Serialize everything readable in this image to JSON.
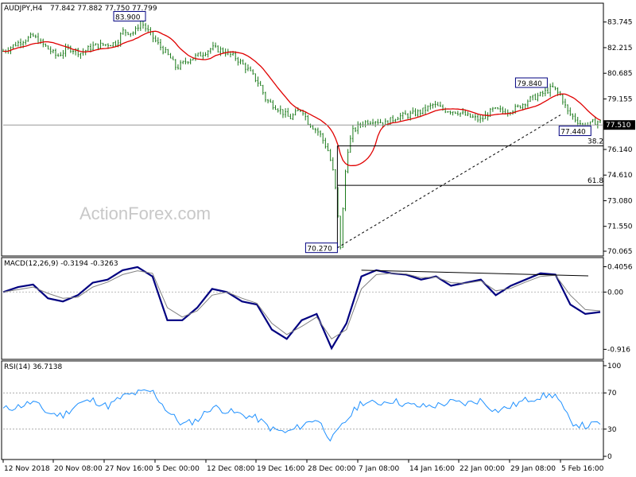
{
  "chart_data": [
    {
      "type": "candlestick",
      "title": "AUDJPY,H4",
      "ohlc_header": "77.842 77.882 77.750 77.799",
      "y_ticks": [
        "83.745",
        "82.215",
        "80.685",
        "79.155",
        "77.510",
        "76.140",
        "74.610",
        "73.080",
        "71.550",
        "70.065"
      ],
      "ylim": [
        70.065,
        84.3
      ],
      "overlay_series": [
        {
          "type": "moving-average",
          "color": "#e00000"
        }
      ],
      "last_price": "77.510",
      "price_line": 77.6,
      "annotations": [
        {
          "text": "83.900",
          "x_date": "1 Dec 2018",
          "value": 83.9
        },
        {
          "text": "70.270",
          "x_date": "3 Jan 2019",
          "value": 70.27
        },
        {
          "text": "79.840",
          "x_date": "1 Feb 2019",
          "value": 79.84
        },
        {
          "text": "77.440",
          "x_date": "7 Feb 2019",
          "value": 77.44
        }
      ],
      "fib_levels": [
        {
          "label": "38.2",
          "value": 76.35
        },
        {
          "label": "61.8",
          "value": 74.0
        }
      ],
      "trendline": {
        "from": {
          "x_date": "3 Jan 2019",
          "value": 70.27
        },
        "to": {
          "x_date": "5 Feb 2019",
          "value": 78.2
        }
      },
      "price_path": [
        [
          0,
          82.0
        ],
        [
          0.03,
          82.6
        ],
        [
          0.05,
          82.9
        ],
        [
          0.07,
          82.3
        ],
        [
          0.09,
          81.7
        ],
        [
          0.11,
          82.2
        ],
        [
          0.13,
          81.9
        ],
        [
          0.15,
          82.3
        ],
        [
          0.17,
          82.4
        ],
        [
          0.19,
          82.5
        ],
        [
          0.2,
          83.2
        ],
        [
          0.22,
          83.1
        ],
        [
          0.23,
          83.8
        ],
        [
          0.24,
          83.3
        ],
        [
          0.26,
          82.4
        ],
        [
          0.28,
          81.6
        ],
        [
          0.29,
          81.0
        ],
        [
          0.31,
          81.5
        ],
        [
          0.33,
          81.8
        ],
        [
          0.35,
          82.2
        ],
        [
          0.37,
          82.0
        ],
        [
          0.39,
          81.6
        ],
        [
          0.41,
          80.9
        ],
        [
          0.43,
          80.0
        ],
        [
          0.44,
          79.1
        ],
        [
          0.46,
          78.6
        ],
        [
          0.48,
          78.0
        ],
        [
          0.5,
          78.6
        ],
        [
          0.51,
          77.8
        ],
        [
          0.53,
          77.1
        ],
        [
          0.545,
          76.0
        ],
        [
          0.555,
          74.4
        ],
        [
          0.565,
          70.3
        ],
        [
          0.575,
          75.8
        ],
        [
          0.585,
          77.2
        ],
        [
          0.6,
          77.7
        ],
        [
          0.62,
          77.9
        ],
        [
          0.64,
          77.7
        ],
        [
          0.66,
          78.1
        ],
        [
          0.68,
          78.2
        ],
        [
          0.7,
          78.4
        ],
        [
          0.72,
          78.8
        ],
        [
          0.74,
          78.5
        ],
        [
          0.76,
          78.4
        ],
        [
          0.78,
          78.1
        ],
        [
          0.8,
          77.9
        ],
        [
          0.82,
          78.5
        ],
        [
          0.84,
          78.4
        ],
        [
          0.86,
          78.6
        ],
        [
          0.88,
          79.1
        ],
        [
          0.9,
          79.4
        ],
        [
          0.92,
          79.84
        ],
        [
          0.935,
          79.3
        ],
        [
          0.945,
          78.4
        ],
        [
          0.96,
          77.9
        ],
        [
          0.975,
          77.44
        ],
        [
          0.99,
          77.8
        ]
      ],
      "x_ticks": [
        "12 Nov 2018",
        "20 Nov 08:00",
        "27 Nov 16:00",
        "5 Dec 00:00",
        "12 Dec 08:00",
        "19 Dec 16:00",
        "28 Dec 00:00",
        "7 Jan 08:00",
        "14 Jan 16:00",
        "22 Jan 00:00",
        "29 Jan 08:00",
        "5 Feb 16:00"
      ]
    },
    {
      "type": "line",
      "title": "MACD(12,26,9) -0.3194 -0.3263",
      "y_ticks": [
        "0.4056",
        "0.00",
        "-0.916"
      ],
      "ylim": [
        -1.0,
        0.45
      ],
      "series": [
        {
          "color": "#000080",
          "values": [
            0.0,
            0.08,
            0.12,
            -0.1,
            -0.15,
            -0.05,
            0.15,
            0.2,
            0.35,
            0.4,
            0.25,
            -0.45,
            -0.45,
            -0.25,
            0.05,
            0.0,
            -0.15,
            -0.2,
            -0.6,
            -0.75,
            -0.45,
            -0.35,
            -0.9,
            -0.5,
            0.25,
            0.35,
            0.3,
            0.28,
            0.2,
            0.25,
            0.1,
            0.15,
            0.2,
            -0.05,
            0.1,
            0.2,
            0.3,
            0.28,
            -0.2,
            -0.35,
            -0.32
          ]
        },
        {
          "color": "#808080",
          "values": [
            0.0,
            0.04,
            0.08,
            -0.02,
            -0.1,
            -0.08,
            0.08,
            0.16,
            0.28,
            0.34,
            0.3,
            -0.25,
            -0.4,
            -0.3,
            -0.05,
            0.0,
            -0.1,
            -0.18,
            -0.5,
            -0.68,
            -0.55,
            -0.4,
            -0.75,
            -0.6,
            0.05,
            0.28,
            0.3,
            0.29,
            0.23,
            0.24,
            0.15,
            0.14,
            0.18,
            0.02,
            0.06,
            0.16,
            0.25,
            0.27,
            -0.05,
            -0.28,
            -0.3
          ]
        }
      ],
      "signal_trendline": {
        "from": 0.35,
        "to": 0.26
      }
    },
    {
      "type": "line",
      "title": "RSI(14) 36.7138",
      "y_ticks": [
        "100",
        "70",
        "30",
        "0"
      ],
      "ylim": [
        0,
        100
      ],
      "series": [
        {
          "color": "#1e90ff",
          "values": [
            52,
            55,
            60,
            48,
            45,
            58,
            62,
            55,
            66,
            70,
            72,
            50,
            35,
            40,
            55,
            50,
            46,
            42,
            30,
            26,
            34,
            42,
            18,
            40,
            60,
            58,
            62,
            57,
            55,
            56,
            60,
            58,
            62,
            50,
            55,
            62,
            66,
            68,
            38,
            33,
            37
          ]
        }
      ]
    }
  ],
  "watermark": "ActionForex.com",
  "colors": {
    "candle_up": "#1a7a1a",
    "ma": "#e00000",
    "macd": "#000080",
    "signal": "#808080",
    "rsi": "#1e90ff",
    "axis_box": "#ffffff"
  }
}
